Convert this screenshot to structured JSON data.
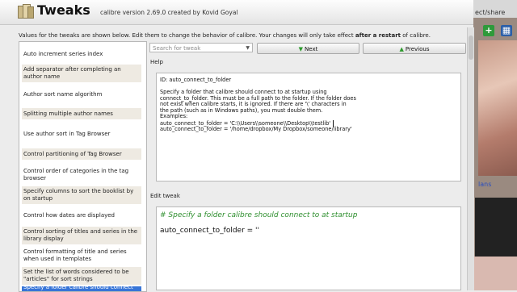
{
  "background": {
    "top_text": "ect/share",
    "link_text": "lans",
    "plus_icon": "+",
    "grid_icon": "▦"
  },
  "window": {
    "title": "Tweaks",
    "subtitle": "calibre version 2.69.0 created by Kovid Goyal",
    "info_prefix": "Values for the tweaks are shown below. Edit them to change the behavior of calibre. Your changes will only take effect",
    "info_bold": "after a restart",
    "info_suffix": "of calibre."
  },
  "sidebar": {
    "items": [
      {
        "label": "Auto increment series index"
      },
      {
        "label": "Add separator after completing an author name"
      },
      {
        "label": "Author sort name algorithm"
      },
      {
        "label": "Splitting multiple author names"
      },
      {
        "label": "Use author sort in Tag Browser"
      },
      {
        "label": "Control partitioning of Tag Browser"
      },
      {
        "label": "Control order of categories in the tag browser"
      },
      {
        "label": "Specify columns to sort the booklist by on startup"
      },
      {
        "label": "Control how dates are displayed"
      },
      {
        "label": "Control sorting of titles and series in the library display"
      },
      {
        "label": "Control formatting of title and series when used in templates"
      },
      {
        "label": "Set the list of words considered to be \"articles\" for sort strings"
      },
      {
        "label": "Specify a folder calibre should connect to at startup"
      }
    ]
  },
  "search": {
    "placeholder": "Search for tweak"
  },
  "buttons": {
    "next": "Next",
    "previous": "Previous"
  },
  "help": {
    "label": "Help",
    "id_line": "ID: auto_connect_to_folder",
    "lines": [
      "Specify a folder that calibre should connect to at startup using",
      "connect_to_folder. This must be a full path to the folder. If the folder does",
      "not exist when calibre starts, it is ignored. If there are '\\' characters in",
      "the path (such as in Windows paths), you must double them.",
      "Examples:",
      "auto_connect_to_folder = 'C:\\\\Users\\\\someone\\\\Desktop\\\\testlib'",
      "auto_connect_to_folder = '/home/dropbox/My Dropbox/someone/library'"
    ]
  },
  "edit": {
    "label": "Edit tweak",
    "comment": "# Specify a folder calibre should connect to at startup",
    "code": "auto_connect_to_folder = ''"
  }
}
